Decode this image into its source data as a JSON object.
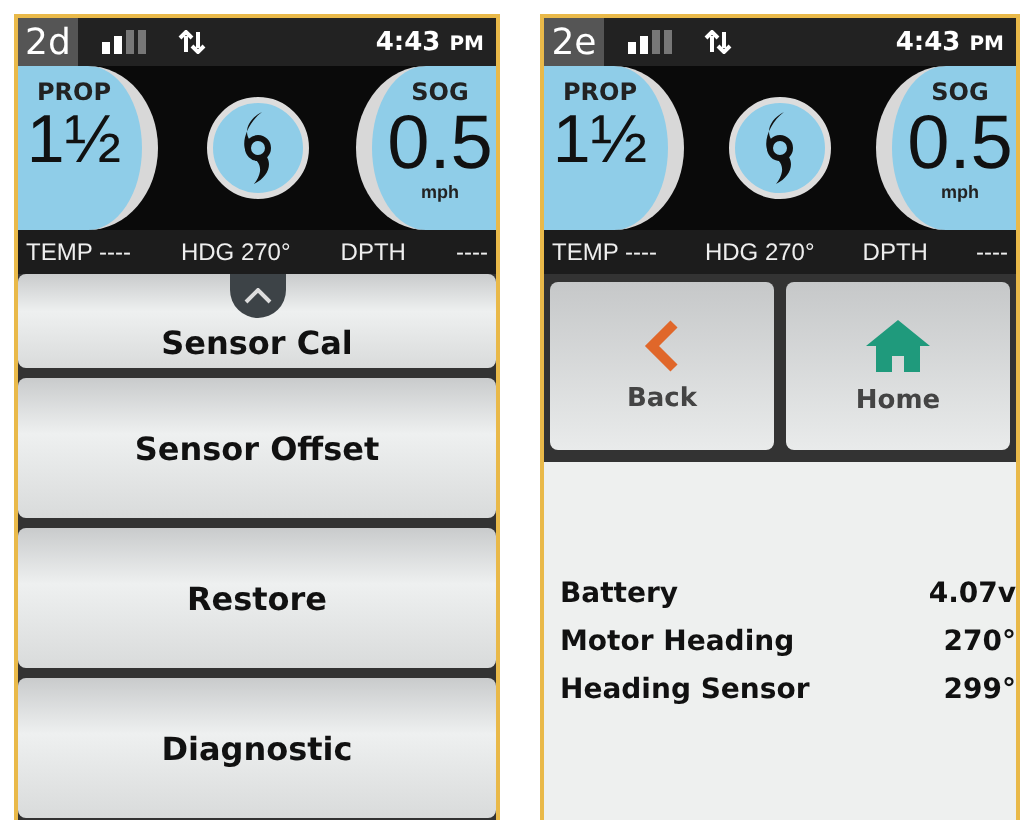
{
  "panels": [
    {
      "kind": "menu",
      "badge": "2d",
      "time": "4:43",
      "time_suffix": "PM",
      "prop_label": "PROP",
      "prop_value": "1½",
      "sog_label": "SOG",
      "sog_value": "0.5",
      "sog_unit": "mph",
      "strip": [
        "TEMP ----",
        "HDG 270°",
        "DPTH",
        "----"
      ],
      "menu": [
        "Sensor Cal",
        "Sensor Offset",
        "Restore",
        "Diagnostic"
      ]
    },
    {
      "kind": "info",
      "badge": "2e",
      "time": "4:43",
      "time_suffix": "PM",
      "prop_label": "PROP",
      "prop_value": "1½",
      "sog_label": "SOG",
      "sog_value": "0.5",
      "sog_unit": "mph",
      "strip": [
        "TEMP ----",
        "HDG 270°",
        "DPTH",
        "----"
      ],
      "nav_buttons": [
        {
          "kind": "back",
          "label": "Back"
        },
        {
          "kind": "home",
          "label": "Home"
        }
      ],
      "readings": [
        {
          "label": "Battery",
          "value": "4.07v"
        },
        {
          "label": "Motor Heading",
          "value": "270°"
        },
        {
          "label": "Heading Sensor",
          "value": "299°"
        }
      ]
    }
  ]
}
